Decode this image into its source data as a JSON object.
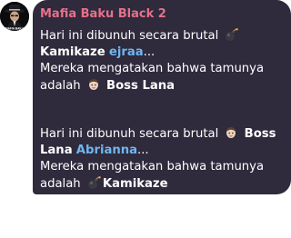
{
  "avatar": {
    "label": "MAFIA BAKU",
    "icon": "mafia-avatar"
  },
  "chat": {
    "sender": "Mafia Baku Black 2",
    "messages": [
      {
        "line1_text": "Hari ini dibunuh secara brutal",
        "line1_icon": "bomb-icon",
        "line2_name": "Kamikaze",
        "line2_blue": "ejraa",
        "line2_suffix": "...",
        "line3_text": "Mereka mengatakan bahwa tamunya",
        "line4_text": "adalah",
        "line4_icon": "boss-face-icon",
        "line4_name": "Boss Lana"
      },
      {
        "line1_text": "Hari ini dibunuh secara brutal",
        "line1_icon": "boss-face-icon",
        "line1_name": "Boss",
        "line2_name": "Lana",
        "line2_blue": "Abrianna",
        "line2_suffix": "...",
        "line3_text": "Mereka mengatakan bahwa tamunya",
        "line4_text": "adalah",
        "line4_icon": "bomb-icon",
        "line4_name": "Kamikaze"
      }
    ]
  },
  "colors": {
    "bubble_bg": "#2f2a3c",
    "sender": "#e8708a",
    "name_blue": "#6fb6f0",
    "text": "#ffffff"
  }
}
